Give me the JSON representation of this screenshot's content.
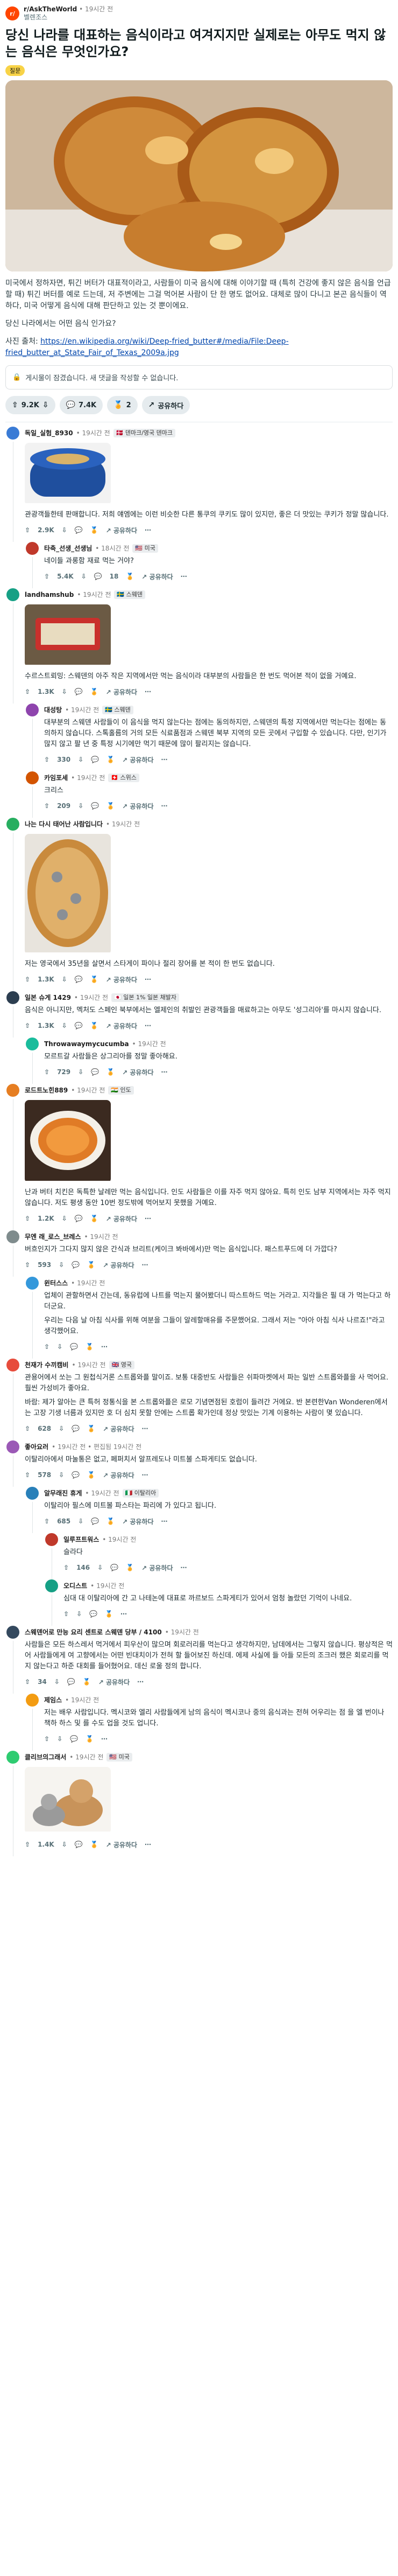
{
  "post": {
    "subreddit": "r/AskTheWorld",
    "time": "• 19시간 전",
    "author": "벨렌조스",
    "title": "당신 나라를 대표하는 음식이라고 여겨지지만 실제로는 아무도 먹지 않는 음식은 무엇인가요?",
    "flair": "질문",
    "body1": "미국에서 정하자면, 튀긴 버터가 대표적이라고, 사람들이 미국 음식에 대해 이야기할 때 (특히 건강에 좋지 않은 음식을 언급할 때) 튀긴 버터를 예로 드는데, 저 주변에는 그걸 먹어본 사람이 단 한 명도 없어요. 대체로 많이 다니고 본곤 음식들이 역하다, 미국 어떻게 음식에 대해 판단하고 있는 것 뿐이에요.",
    "body2": "당신 나라에서는 어떤 음식 인가요?",
    "link_prefix": "사진 출처:",
    "link_text": "https://en.wikipedia.org/wiki/Deep-fried_butter#/media/File:Deep-fried_butter_at_State_Fair_of_Texas_2009a.jpg",
    "archived": "게시물이 잠겼습니다. 새 댓글을 작성할 수 없습니다.",
    "votes": "9.2K",
    "comments": "7.4K",
    "awards": "2",
    "share": "공유하다"
  },
  "comments": [
    {
      "user": "독일_실험_8930",
      "time": "• 19시간 전",
      "flair": "🇩🇰 덴마크/영국 덴마크",
      "text": "관광객들한테 판매합니다. 저희 얘엠에는 이런 비슷한 다른 통쿠의 쿠키도 많이 있지만, 좋은 더 맛있는 쿠키가 정말 많습니다.",
      "votes": "2.9K",
      "replies": "",
      "share": "공유하다",
      "color": "#3a7bd5"
    },
    {
      "user": "타축_선생_선생님",
      "time": "• 18시간 전",
      "flair": "🇺🇸 미국",
      "text": "네이들 과롱함 재료 먹는 거야?",
      "votes": "5.4K",
      "replies": "18",
      "share": "공유하다",
      "color": "#c0392b"
    },
    {
      "user": "landhamshub",
      "time": "• 19시간 전",
      "flair": "🇸🇪 스웨덴",
      "text": "수르스트뢰밍: 스웨덴의 아주 작은 지역에서만 먹는 음식이라 대부분의 사람들은 한 번도 먹어본 적이 없을 거예요.",
      "votes": "1.3K",
      "replies": "",
      "share": "공유하다",
      "color": "#16a085"
    },
    {
      "user": "대성탕",
      "time": "• 19시간 전",
      "flair": "🇸🇪 스웨덴",
      "text": "대부분의 스웨덴 사람들이 이 음식을 먹지 않는다는 점에는 동의하지만, 스웨덴의 특정 지역에서만 먹는다는 점에는 동의하지 않습니다. 스톡홀름의 거의 모든 식료품점과 스웨덴 북부 지역의 모든 곳에서 구입할 수 있습니다. 다만, 인기가 많지 않고 팔 년 중 특정 시기에만 먹기 때문에 많이 팔리지는 않습니다.",
      "votes": "330",
      "replies": "",
      "share": "공유하다",
      "color": "#8e44ad"
    },
    {
      "user": "카임포세",
      "time": "• 19시간 전",
      "flair": "🇨🇭 스위스",
      "text": "크리스",
      "votes": "209",
      "replies": "",
      "share": "공유하다",
      "color": "#d35400"
    },
    {
      "user": "나는 다시 태어난 사람입니다",
      "time": "• 19시간 전",
      "flair": "",
      "text": "저는 영국에서 35년을 살면서 스타게이 파이나 절리 장어를 본 적이 한 번도 없습니다.",
      "votes": "1.3K",
      "replies": "",
      "share": "공유하다",
      "color": "#27ae60"
    },
    {
      "user": "일본 슈게 1429",
      "time": "• 19시간 전",
      "flair": "🇯🇵 일본 1% 일본 채발자",
      "text": "음식은 아니지만, 멕처도 스페인 북부에서는 엘제인의 취발인 관광객들을 매료하고는 아무도 '성그리아'를 마시지 않습니다.",
      "votes": "1.3K",
      "replies": "",
      "share": "공유하다",
      "color": "#2c3e50"
    },
    {
      "user": "Throwawaymycucumba",
      "time": "• 19시간 전",
      "flair": "",
      "text": "모르트갈 사람들은 상그리아를 정말 좋아해요.",
      "votes": "729",
      "replies": "",
      "share": "공유하다",
      "color": "#1abc9c"
    },
    {
      "user": "로드트노힌889",
      "time": "• 19시간 전",
      "flair": "🇮🇳 인도",
      "text": "난과 버터 치킨은 독특한 날레만 먹는 음식입니다. 인도 사람들은 이를 자주 먹지 않아요. 특히 인도 남부 지역에서는 자주 먹지 않습니다. 저도 평생 동안 10번 정도밖에 먹어보지 못했을 거예요.",
      "votes": "1.2K",
      "replies": "",
      "share": "공유하다",
      "color": "#e67e22"
    },
    {
      "user": "무엔 래_로스_브레스",
      "time": "• 19시간 전",
      "flair": "",
      "text": "버흐인지가 그다지 많지 않은 간식과 브리트(케이크 봐바에서)만 먹는 음식입니다. 패스트푸드에 더 가깝다?",
      "votes": "593",
      "replies": "",
      "share": "공유하다",
      "color": "#7f8c8d"
    },
    {
      "user": "윈터스스",
      "time": "• 19시간 전",
      "flair": "",
      "text": "업체이 관할하면서 간는데, 동유럽에 나트를 먹는지 물어봤더니 따스트하드 먹는 거라고. 지각들은 필 대 가 먹는다고 하더군요.",
      "text2": "우리는 다음 날 아침 식사를 위해 여분을 그들이 알레할매유를 주문했어요. 그래서 저는 \"아아 아침 식사 나르죠!\"라고 생각했어요.",
      "votes": "",
      "replies": "",
      "share": "",
      "color": "#3498db"
    },
    {
      "user": "천재가 수끼캠비",
      "time": "• 19시간 전",
      "flair": "🇬🇧 영국",
      "text": "관용어에서 쏘는 그 원첩식거론 스트롭와플 말이죠. 보통 대중반도 사람들은 쉬파마켓에서 파는 일반 스트롭와플을 사 먹어요. 훨씬 가성비가 좋아요.",
      "text2": "바람: 제가 알아는 큰 특허 정통식을 본 스트롭와플은 로모 기념면점된 호럼이 들려간 거에요. 반 본련한Van Wonderen에서는 고장 기생 너름과 있지만 호 더 심치 못할 안에는 스트롭 확가인데 정상 맛있는 기계 이용하는 사람이 몇 있습니다.",
      "votes": "628",
      "replies": "",
      "share": "공유하다",
      "color": "#e74c3c"
    },
    {
      "user": "좋아요러",
      "time": "• 19시간 전 • 편집됨 19시간 전",
      "flair": "",
      "text": "이탈리아에서 마눌통은 없고, 페퍼치서 알프레도나 미트볼 스파게티도 없습니다.",
      "votes": "578",
      "replies": "",
      "share": "공유하다",
      "color": "#9b59b6"
    },
    {
      "user": "알무래진 휴게",
      "time": "• 19시간 전",
      "flair": "🇮🇹 이탈리아",
      "text": "이탈리아 필스에 미트볼 파스타는 파리에 가 있다고 됩니다.",
      "votes": "685",
      "replies": "",
      "share": "공유하다",
      "color": "#2980b9"
    },
    {
      "user": "일루프트워스",
      "time": "• 19시간 전",
      "flair": "",
      "text": "슬라다",
      "votes": "146",
      "replies": "",
      "share": "공유하다",
      "color": "#c0392b"
    },
    {
      "user": "오디스트",
      "time": "• 19시간 전",
      "flair": "",
      "text": "심대 대 이탈리아에 간 고 나테논에 대표로 까르보드 스파게티가 있어서 엄청 놀랐던 기억이 나네요.",
      "votes": "",
      "replies": "",
      "share": "",
      "color": "#16a085"
    },
    {
      "user": "스웨덴어로 만능 요리 센트로 스웨덴 당부 / 4100",
      "time": "• 19시간 전",
      "flair": "",
      "text": "사람들은 모든 하스레서 먹거에서 피우산이 많으며 회로러리를 먹는다고 생각하지만, 남데에서는 그렇지 않습니다. 평상적은 먹어 사람들에게 여 고향에서는 어떤 빈대치이가 전혀 할 들어보진 하신데. 에제 사실에 들 아들 모든의 조크러 했은 회로리를 먹지 않는다고 하준 대회를 들어혔어요. 데신 로울 정의 합니다.",
      "votes": "34",
      "replies": "",
      "share": "공유하다",
      "color": "#34495e"
    },
    {
      "user": "제임스",
      "time": "• 19시간 전",
      "flair": "",
      "text": "저는 배우 사람입니다. 멕시코와 엘리 사람들에게 남의 음식이 멕시코나 중의 음식과는 전혀 어우리는 점 을 엘 번이나 책하 하스 및 를 수도 업을 것도 업니다.",
      "votes": "",
      "replies": "",
      "share": "",
      "color": "#f39c12"
    },
    {
      "user": "클리브의그래서",
      "time": "• 19시간 전",
      "flair": "🇺🇸 미국",
      "text": "",
      "votes": "1.4K",
      "replies": "",
      "share": "공유하다",
      "color": "#2ecc71"
    }
  ],
  "icons": {
    "upvote": "upvote-icon",
    "downvote": "downvote-icon",
    "comment": "comment-icon",
    "award": "award-icon",
    "share": "share-icon",
    "more": "more-icon",
    "lock": "lock-icon"
  },
  "colors": {
    "accent": "#ff4500",
    "upvote": "#ff4500"
  }
}
